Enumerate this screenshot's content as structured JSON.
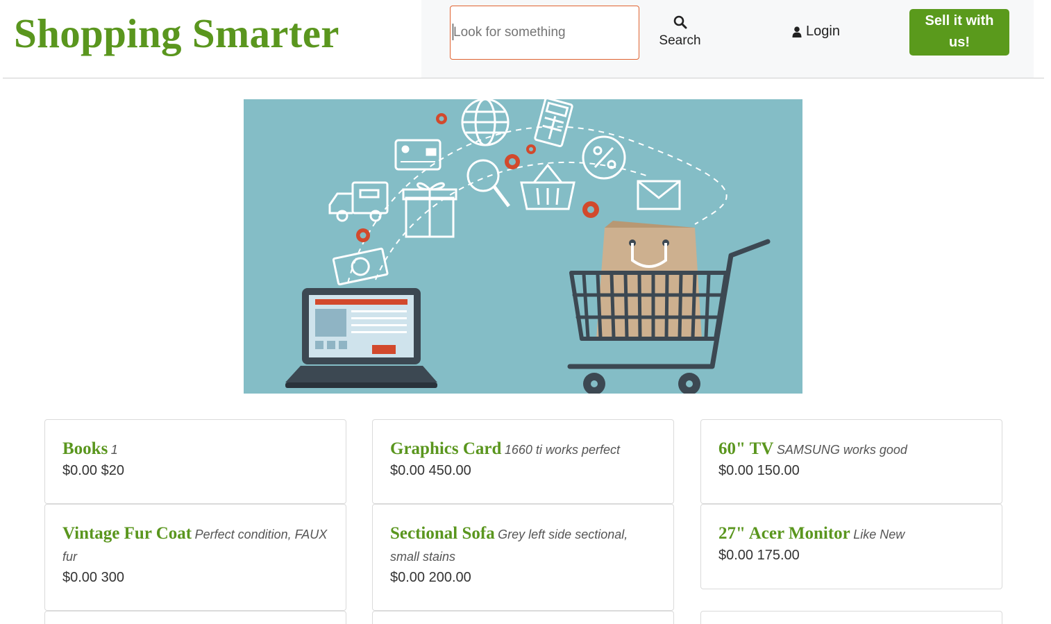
{
  "brand": {
    "title": "Shopping Smarter"
  },
  "nav": {
    "search_placeholder": "Look for something",
    "search_label": "Search",
    "login_label": "Login",
    "sell_line1": "Sell it with",
    "sell_line2": "us!"
  },
  "hero": {
    "illustration": "online-shopping-illustration"
  },
  "colors": {
    "brand_green": "#5a961e",
    "button_green": "#5a9a1c",
    "input_border": "#e0622f",
    "hero_bg": "#84bdc6"
  },
  "listings": [
    {
      "title": "Books",
      "desc": "1",
      "price": "$0.00 $20"
    },
    {
      "title": "Graphics Card",
      "desc": "1660 ti works perfect",
      "price": "$0.00 450.00"
    },
    {
      "title": "60\" TV",
      "desc": "SAMSUNG works good",
      "price": "$0.00 150.00"
    },
    {
      "title": "Vintage Fur Coat",
      "desc": "Perfect condition, FAUX fur",
      "price": "$0.00 300"
    },
    {
      "title": "Sectional Sofa",
      "desc": "Grey left side sectional, small stains",
      "price": "$0.00 200.00"
    },
    {
      "title": "27\" Acer Monitor",
      "desc": "Like New",
      "price": "$0.00 175.00"
    }
  ]
}
